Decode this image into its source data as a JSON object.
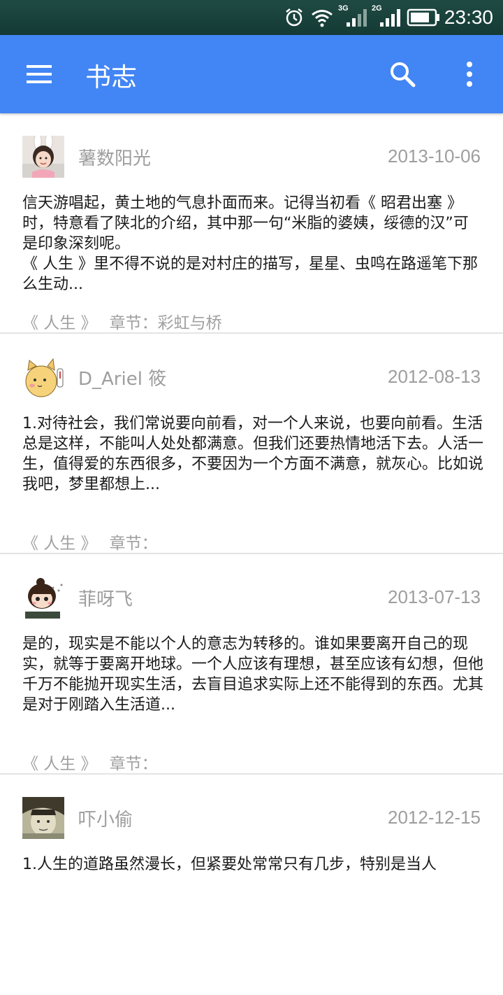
{
  "status_bar": {
    "time": "23:30",
    "network_1": "3G",
    "network_2": "2G",
    "icons": [
      "alarm-icon",
      "wifi-icon",
      "signal-3g-icon",
      "signal-2g-icon",
      "battery-icon"
    ]
  },
  "app_bar": {
    "title": "书志",
    "menu_icon": "hamburger-menu-icon",
    "search_icon": "search-icon",
    "more_icon": "more-vert-icon",
    "color": "#4285f4"
  },
  "posts": [
    {
      "username": "薯数阳光",
      "date": "2013-10-06",
      "body": "信天游唱起，黄土地的气息扑面而来。记得当初看《 昭君出塞 》时，特意看了陕北的介绍，其中那一句“米脂的婆姨，绥德的汉”可是印象深刻呢。\n《 人生 》里不得不说的是对村庄的描写，星星、虫鸣在路遥笔下那么生动...",
      "book": "《 人生 》",
      "chapter": "章节：彩虹与桥"
    },
    {
      "username": "D_Ariel 筱",
      "date": "2012-08-13",
      "body": "1.对待社会，我们常说要向前看，对一个人来说，也要向前看。生活总是这样，不能叫人处处都满意。但我们还要热情地活下去。人活一生，值得爱的东西很多，不要因为一个方面不满意，就灰心。比如说我吧，梦里都想上...",
      "book": "《 人生 》",
      "chapter": "章节："
    },
    {
      "username": "菲呀飞",
      "date": "2013-07-13",
      "body": "是的，现实是不能以个人的意志为转移的。谁如果要离开自己的现实，就等于要离开地球。一个人应该有理想，甚至应该有幻想，但他千万不能抛开现实生活，去盲目追求实际上还不能得到的东西。尤其是对于刚踏入生活道...",
      "book": "《 人生 》",
      "chapter": "章节："
    },
    {
      "username": "吓小偷",
      "date": "2012-12-15",
      "body": "1.人生的道路虽然漫长，但紧要处常常只有几步，特别是当人",
      "book": "",
      "chapter": ""
    }
  ]
}
